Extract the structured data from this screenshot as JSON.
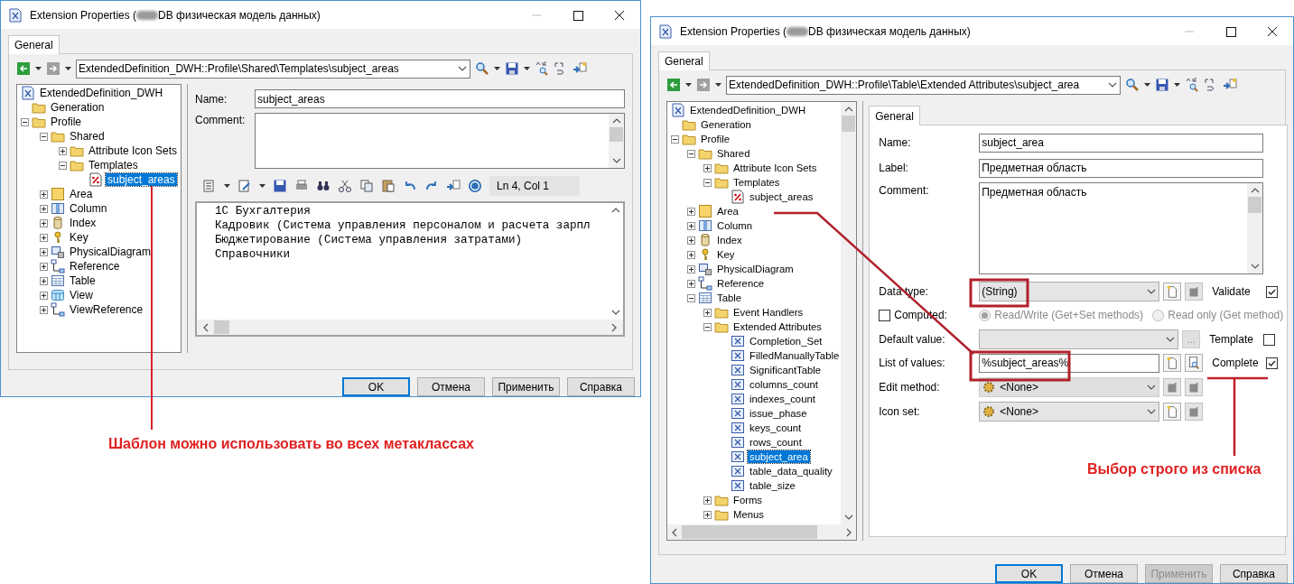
{
  "left_window": {
    "title_prefix": "Extension Properties (",
    "title_suffix": "DB физическая модель данных)",
    "tabs": [
      {
        "label": "General",
        "selected": true
      }
    ],
    "path": "ExtendedDefinition_DWH::Profile\\Shared\\Templates\\subject_areas",
    "tree": [
      {
        "label": "ExtendedDefinition_DWH",
        "kind": "model",
        "selected": false,
        "children": [
          {
            "label": "Generation",
            "kind": "folder",
            "selected": false
          },
          {
            "label": "Profile",
            "kind": "folder",
            "selected": false,
            "expanded": true,
            "children": [
              {
                "label": "Shared",
                "kind": "folder",
                "selected": false,
                "expanded": true,
                "children": [
                  {
                    "label": "Attribute Icon Sets",
                    "kind": "folder",
                    "selected": false,
                    "expanded": false
                  },
                  {
                    "label": "Templates",
                    "kind": "folder",
                    "selected": false,
                    "expanded": true,
                    "children": [
                      {
                        "label": "subject_areas",
                        "kind": "template",
                        "selected": true
                      }
                    ]
                  }
                ]
              },
              {
                "label": "Area",
                "kind": "area",
                "selected": false,
                "expanded": false
              },
              {
                "label": "Column",
                "kind": "column",
                "selected": false,
                "expanded": false
              },
              {
                "label": "Index",
                "kind": "index",
                "selected": false,
                "expanded": false
              },
              {
                "label": "Key",
                "kind": "key",
                "selected": false,
                "expanded": false
              },
              {
                "label": "PhysicalDiagram",
                "kind": "diagram",
                "selected": false,
                "expanded": false
              },
              {
                "label": "Reference",
                "kind": "reference",
                "selected": false,
                "expanded": false
              },
              {
                "label": "Table",
                "kind": "table",
                "selected": false,
                "expanded": false
              },
              {
                "label": "View",
                "kind": "view",
                "selected": false,
                "expanded": false
              },
              {
                "label": "ViewReference",
                "kind": "reference",
                "selected": false,
                "expanded": false
              }
            ]
          }
        ]
      }
    ],
    "name": {
      "label": "Name:",
      "value": "subject_areas"
    },
    "comment": {
      "label": "Comment:"
    },
    "status": "Ln 4, Col 1",
    "lines": [
      "1С Бухгалтерия",
      "Кадровик (Система управления персоналом и расчета зарпл",
      "Бюджетирование (Система управления затратами)",
      "Справочники"
    ],
    "buttons": [
      {
        "label": "OK",
        "default": true,
        "disabled": false
      },
      {
        "label": "Отмена",
        "default": false,
        "disabled": false
      },
      {
        "label": "Применить",
        "default": false,
        "disabled": false
      },
      {
        "label": "Справка",
        "default": false,
        "disabled": false
      }
    ]
  },
  "right_window": {
    "title_prefix": "Extension Properties (",
    "title_suffix": "DB физическая модель данных)",
    "tabs": [
      {
        "label": "General",
        "selected": true
      }
    ],
    "path": "ExtendedDefinition_DWH::Profile\\Table\\Extended Attributes\\subject_area",
    "tree": [
      {
        "label": "ExtendedDefinition_DWH",
        "kind": "model",
        "selected": false,
        "children": [
          {
            "label": "Generation",
            "kind": "folder",
            "selected": false
          },
          {
            "label": "Profile",
            "kind": "folder",
            "selected": false,
            "expanded": true,
            "children": [
              {
                "label": "Shared",
                "kind": "folder",
                "selected": false,
                "expanded": true,
                "children": [
                  {
                    "label": "Attribute Icon Sets",
                    "kind": "folder",
                    "selected": false,
                    "expanded": false
                  },
                  {
                    "label": "Templates",
                    "kind": "folder",
                    "selected": false,
                    "expanded": true,
                    "children": [
                      {
                        "label": "subject_areas",
                        "kind": "template",
                        "selected": false
                      }
                    ]
                  }
                ]
              },
              {
                "label": "Area",
                "kind": "area",
                "selected": false,
                "expanded": false
              },
              {
                "label": "Column",
                "kind": "column",
                "selected": false,
                "expanded": false
              },
              {
                "label": "Index",
                "kind": "index",
                "selected": false,
                "expanded": false
              },
              {
                "label": "Key",
                "kind": "key",
                "selected": false,
                "expanded": false
              },
              {
                "label": "PhysicalDiagram",
                "kind": "diagram",
                "selected": false,
                "expanded": false
              },
              {
                "label": "Reference",
                "kind": "reference",
                "selected": false,
                "expanded": false
              },
              {
                "label": "Table",
                "kind": "table",
                "selected": false,
                "expanded": true,
                "children": [
                  {
                    "label": "Event Handlers",
                    "kind": "folder",
                    "selected": false,
                    "expanded": false
                  },
                  {
                    "label": "Extended Attributes",
                    "kind": "folder",
                    "selected": false,
                    "expanded": true,
                    "children": [
                      {
                        "label": "Completion_Set",
                        "kind": "attribute",
                        "selected": false
                      },
                      {
                        "label": "FilledManuallyTable",
                        "kind": "attribute",
                        "selected": false
                      },
                      {
                        "label": "SignificantTable",
                        "kind": "attribute",
                        "selected": false
                      },
                      {
                        "label": "columns_count",
                        "kind": "attribute",
                        "selected": false
                      },
                      {
                        "label": "indexes_count",
                        "kind": "attribute",
                        "selected": false
                      },
                      {
                        "label": "issue_phase",
                        "kind": "attribute",
                        "selected": false
                      },
                      {
                        "label": "keys_count",
                        "kind": "attribute",
                        "selected": false
                      },
                      {
                        "label": "rows_count",
                        "kind": "attribute",
                        "selected": false
                      },
                      {
                        "label": "subject_area",
                        "kind": "attribute",
                        "selected": true
                      },
                      {
                        "label": "table_data_quality",
                        "kind": "attribute",
                        "selected": false
                      },
                      {
                        "label": "table_size",
                        "kind": "attribute",
                        "selected": false
                      }
                    ]
                  },
                  {
                    "label": "Forms",
                    "kind": "folder",
                    "selected": false,
                    "expanded": false
                  },
                  {
                    "label": "Menus",
                    "kind": "folder",
                    "selected": false,
                    "expanded": false
                  }
                ]
              }
            ]
          }
        ]
      }
    ],
    "form": {
      "tabs": [
        {
          "label": "General",
          "selected": true
        }
      ],
      "name": {
        "label": "Name:",
        "value": "subject_area"
      },
      "label": {
        "label": "Label:",
        "value": "Предметная область"
      },
      "comment": {
        "label": "Comment:",
        "value": "Предметная область"
      },
      "data_type": {
        "label": "Data type:",
        "value": "(String)"
      },
      "validate": {
        "label": "Validate",
        "checked": true
      },
      "computed": {
        "label": "Computed:",
        "checked": false
      },
      "access": [
        {
          "label": "Read/Write (Get+Set methods)",
          "selected": true,
          "disabled": true
        },
        {
          "label": "Read only (Get method)",
          "selected": false,
          "disabled": true
        }
      ],
      "default_value": {
        "label": "Default value:"
      },
      "more_button": {
        "label": "...",
        "disabled": true
      },
      "template": {
        "label": "Template",
        "checked": false
      },
      "list_of_values": {
        "label": "List of values:",
        "value": "%subject_areas%"
      },
      "complete": {
        "label": "Complete",
        "checked": true
      },
      "edit_method": {
        "label": "Edit method:",
        "value": "<None>",
        "disabled": true
      },
      "icon_set": {
        "label": "Icon set:",
        "value": "<None>",
        "disabled": false
      }
    },
    "buttons": [
      {
        "label": "OK",
        "default": true,
        "disabled": false
      },
      {
        "label": "Отмена",
        "default": false,
        "disabled": false
      },
      {
        "label": "Применить",
        "default": false,
        "disabled": true
      },
      {
        "label": "Справка",
        "default": false,
        "disabled": false
      }
    ]
  },
  "annotations": [
    {
      "text": "Шаблон можно использовать во всех метаклассах"
    },
    {
      "text": "Выбор строго из списка"
    }
  ]
}
